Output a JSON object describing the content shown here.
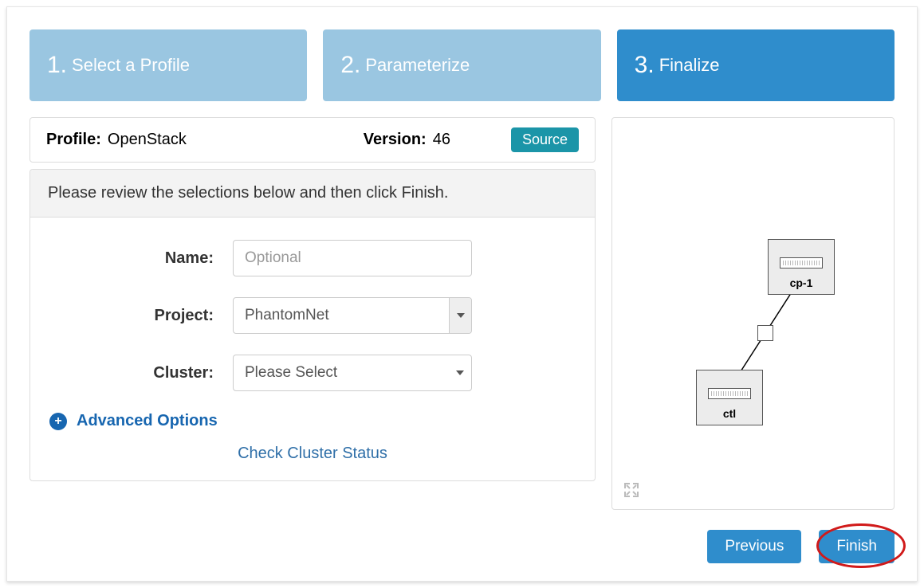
{
  "steps": [
    {
      "num": "1.",
      "label": "Select a Profile"
    },
    {
      "num": "2.",
      "label": "Parameterize"
    },
    {
      "num": "3.",
      "label": "Finalize"
    }
  ],
  "profile_bar": {
    "profile_label": "Profile:",
    "profile_value": "OpenStack",
    "version_label": "Version:",
    "version_value": "46",
    "source_btn": "Source"
  },
  "panel": {
    "instruction": "Please review the selections below and then click Finish.",
    "name_label": "Name:",
    "name_placeholder": "Optional",
    "project_label": "Project:",
    "project_value": "PhantomNet",
    "cluster_label": "Cluster:",
    "cluster_value": "Please Select",
    "advanced": "Advanced Options",
    "check_status": "Check Cluster Status"
  },
  "topology": {
    "node1": "cp-1",
    "node2": "ctl"
  },
  "buttons": {
    "previous": "Previous",
    "finish": "Finish"
  }
}
